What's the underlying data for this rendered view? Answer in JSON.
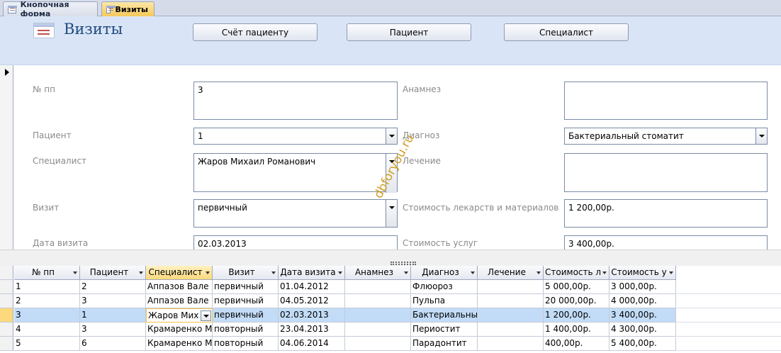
{
  "tabs": [
    {
      "label": "Кнопочная форма",
      "active": false
    },
    {
      "label": "Визиты",
      "active": true
    }
  ],
  "header": {
    "title": "Визиты",
    "buttons": {
      "invoice": "Счёт пациенту",
      "patient": "Пациент",
      "specialist": "Специалист"
    }
  },
  "form": {
    "labels": {
      "num": "№ пп",
      "patient": "Пациент",
      "specialist": "Специалист",
      "visit": "Визит",
      "visit_date": "Дата визита",
      "anamnesis": "Анамнез",
      "diagnosis": "Диагноз",
      "treatment": "Лечение",
      "materials_cost": "Стоимость лекарств и материалов",
      "services_cost": "Стоимость услуг"
    },
    "values": {
      "num": "3",
      "patient": "1",
      "specialist": "Жаров Михаил Романович",
      "visit": "первичный",
      "visit_date": "02.03.2013",
      "anamnesis": "",
      "diagnosis": "Бактериальный стоматит",
      "treatment": "",
      "materials_cost": "1 200,00р.",
      "services_cost": "3 400,00р."
    }
  },
  "watermark": "dbforyou.ru",
  "datasheet": {
    "columns": [
      "№ пп",
      "Пациент",
      "Специалист",
      "Визит",
      "Дата визита",
      "Анамнез",
      "Диагноз",
      "Лечение",
      "Стоимость л",
      "Стоимость у"
    ],
    "active_column": 2,
    "current_row": 2,
    "rows": [
      [
        "1",
        "2",
        "Аппазов Вале",
        "первичный",
        "01.04.2012",
        "",
        "Флюороз",
        "",
        "5 000,00р.",
        "3 000,00р."
      ],
      [
        "2",
        "3",
        "Аппазов Вале",
        "первичный",
        "04.05.2012",
        "",
        "Пульпа",
        "",
        "20 000,00р.",
        "4 000,00р."
      ],
      [
        "3",
        "1",
        "Жаров Мих",
        "первичный",
        "02.03.2013",
        "",
        "Бактериальны",
        "",
        "1 200,00р.",
        "3 400,00р."
      ],
      [
        "4",
        "3",
        "Крамаренко М",
        "повторный",
        "23.04.2013",
        "",
        "Периостит",
        "",
        "1 400,00р.",
        "4 300,00р."
      ],
      [
        "5",
        "6",
        "Крамаренко М",
        "повторный",
        "04.06.2014",
        "",
        "Парадонтит",
        "",
        "400,00р.",
        "5 400,00р."
      ]
    ]
  }
}
